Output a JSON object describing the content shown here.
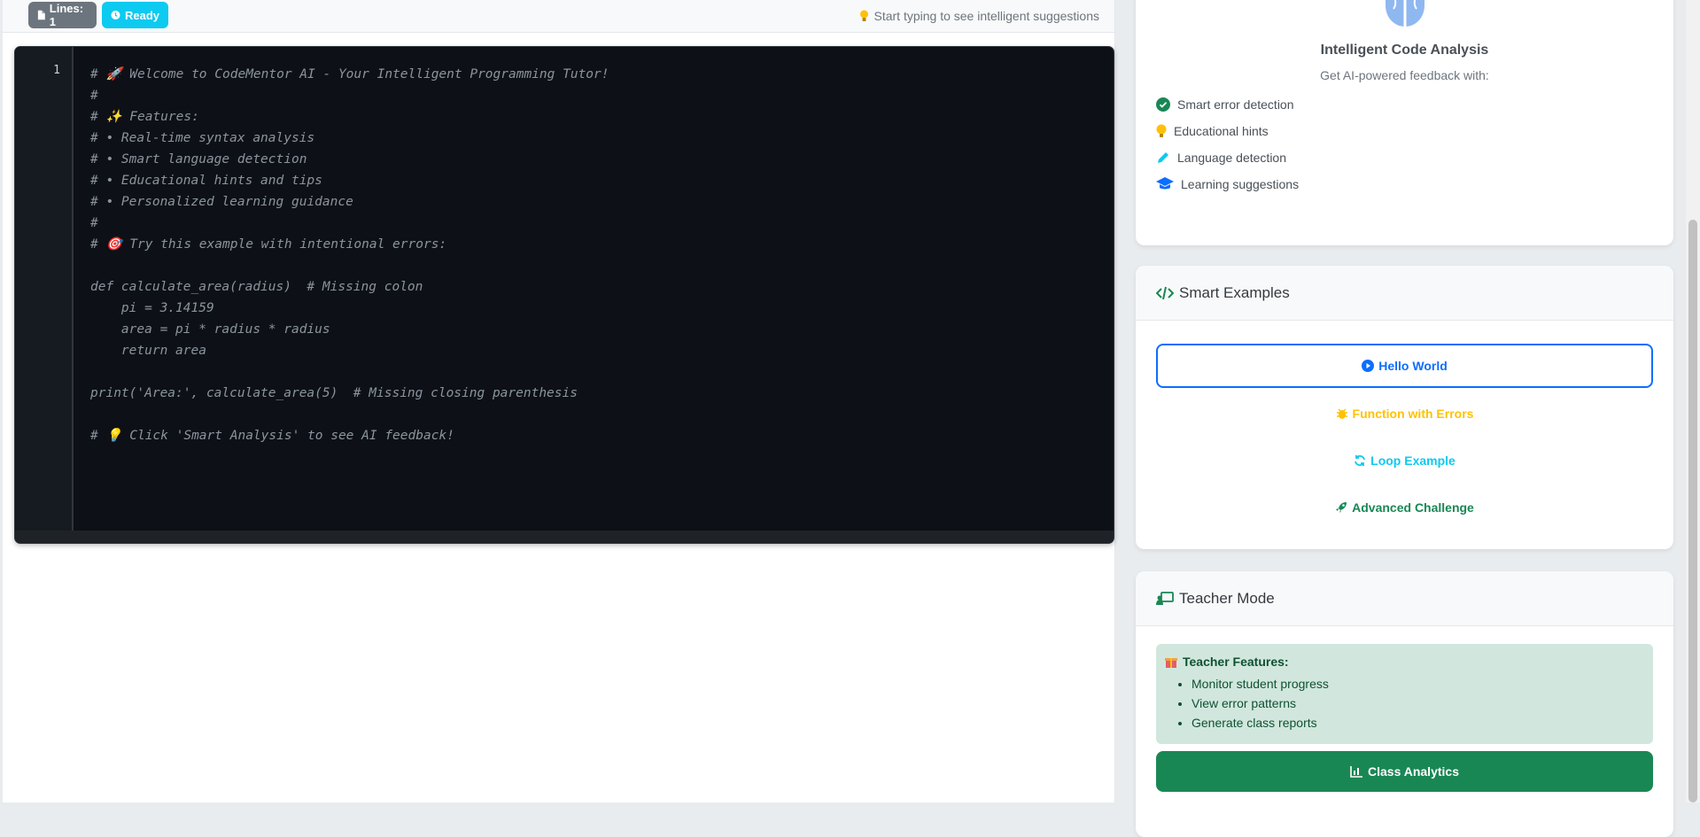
{
  "status_bar": {
    "lines_badge": "Lines: 1",
    "ready_badge": "Ready",
    "hint_text": "Start typing to see intelligent suggestions"
  },
  "editor": {
    "line_number": "1",
    "code": "# 🚀 Welcome to CodeMentor AI - Your Intelligent Programming Tutor!\n#\n# ✨ Features:\n# • Real-time syntax analysis\n# • Smart language detection\n# • Educational hints and tips\n# • Personalized learning guidance\n#\n# 🎯 Try this example with intentional errors:\n\ndef calculate_area(radius)  # Missing colon\n    pi = 3.14159\n    area = pi * radius * radius\n    return area\n\nprint('Area:', calculate_area(5)  # Missing closing parenthesis\n\n# 💡 Click 'Smart Analysis' to see AI feedback!"
  },
  "analysis_card": {
    "title": "Intelligent Code Analysis",
    "subtitle": "Get AI-powered feedback with:",
    "features": [
      {
        "icon": "check-circle-icon",
        "label": "Smart error detection"
      },
      {
        "icon": "lightbulb-icon",
        "label": "Educational hints"
      },
      {
        "icon": "pen-icon",
        "label": "Language detection"
      },
      {
        "icon": "graduation-cap-icon",
        "label": "Learning suggestions"
      }
    ]
  },
  "examples_card": {
    "title": "Smart Examples",
    "buttons": {
      "hello_world": "Hello World",
      "function_errors": "Function with Errors",
      "loop_example": "Loop Example",
      "advanced_challenge": "Advanced Challenge"
    }
  },
  "teacher_card": {
    "title": "Teacher Mode",
    "features_title": "Teacher Features:",
    "features": [
      "Monitor student progress",
      "View error patterns",
      "Generate class reports"
    ],
    "analytics_button": "Class Analytics"
  },
  "colors": {
    "primary": "#0d6efd",
    "info": "#0dcaf0",
    "warning": "#ffc107",
    "success": "#198754",
    "editor_bg": "#0d1117"
  }
}
